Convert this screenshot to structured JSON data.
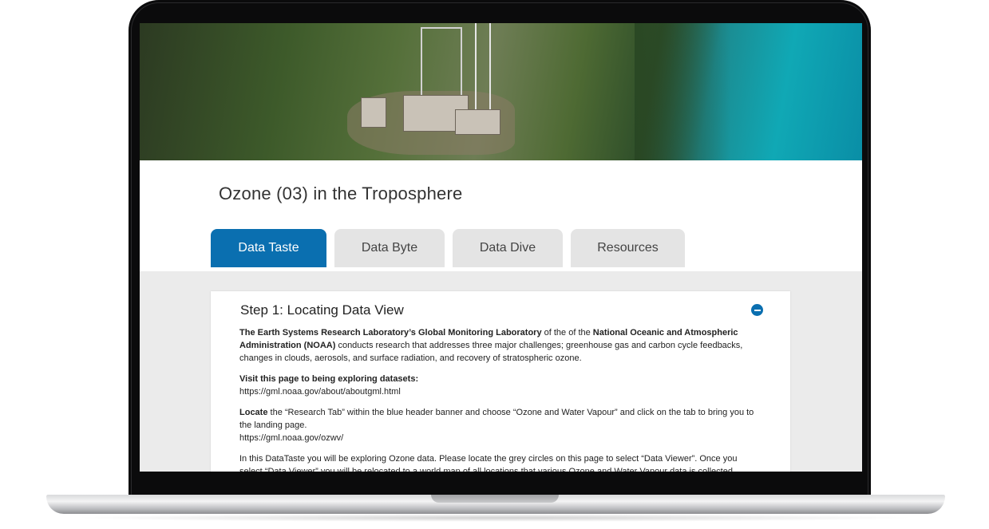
{
  "page": {
    "title": "Ozone (03) in the Troposphere"
  },
  "tabs": [
    {
      "label": "Data Taste",
      "active": true
    },
    {
      "label": "Data Byte",
      "active": false
    },
    {
      "label": "Data Dive",
      "active": false
    },
    {
      "label": "Resources",
      "active": false
    }
  ],
  "step": {
    "title": "Step 1: Locating Data View",
    "intro_bold1": "The Earth Systems Research Laboratory’s Global Monitoring Laboratory",
    "intro_text1": " of the of the ",
    "intro_bold2": "National Oceanic and Atmospheric Administration (NOAA)",
    "intro_text2": " conducts research that addresses three major challenges; greenhouse gas and carbon cycle feedbacks, changes in clouds, aerosols, and surface radiation, and recovery of stratospheric ozone.",
    "visit_heading": "Visit this page to being exploring datasets:",
    "visit_url": "https://gml.noaa.gov/about/aboutgml.html",
    "locate_bold": "Locate",
    "locate_text": " the “Research Tab” within the blue header banner and choose “Ozone and Water Vapour” and click on the tab to bring you to the landing page.",
    "locate_url": "https://gml.noaa.gov/ozwv/",
    "explore_text": "In this DataTaste you will be exploring Ozone data. Please locate the grey circles on this page to select “Data Viewer”. Once you select “Data Viewer” you will be relocated to a world map of all locations that various Ozone and Water Vapour data is collected."
  },
  "colors": {
    "accent": "#0a6fb0",
    "tab_inactive": "#e4e4e4",
    "content_bg": "#ebebeb"
  },
  "icons": {
    "collapse": "minus-circle-icon"
  }
}
